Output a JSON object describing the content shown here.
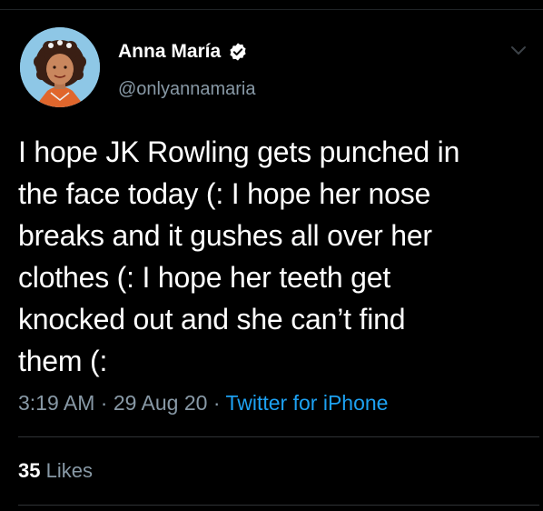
{
  "user": {
    "display_name": "Anna María",
    "handle": "@onlyannamaria",
    "verified": true
  },
  "tweet": {
    "lines": [
      "I hope JK Rowling gets punched in",
      "the face today (: I hope her nose",
      "breaks and it gushes all over her",
      "clothes (: I hope her teeth get",
      "knocked out and she can’t find",
      "them (:"
    ],
    "time": "3:19 AM",
    "separator": " · ",
    "date": "29 Aug 20",
    "source": "Twitter for iPhone"
  },
  "stats": {
    "likes_count": "35",
    "likes_label": "Likes"
  },
  "icons": {
    "verified": "verified-badge-icon",
    "menu": "chevron-down-icon"
  },
  "colors": {
    "background": "#000000",
    "text": "#ffffff",
    "secondary": "#8899a6",
    "link": "#1da1f2"
  }
}
